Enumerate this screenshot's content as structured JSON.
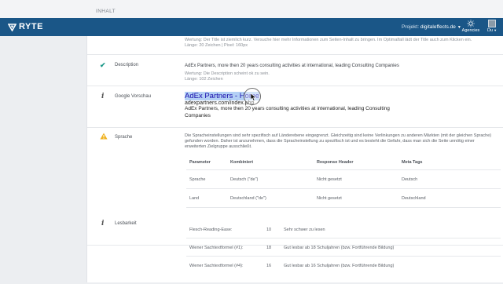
{
  "header": {
    "section_title": "INHALT"
  },
  "navbar": {
    "brand": "RYTE",
    "project_label": "Projekt:",
    "project_value": "digitaleffects.de",
    "agencies_label": "Agencies",
    "user_label": "Du"
  },
  "title_section": {
    "line1": "Wertung: Der Title ist ziemlich kurz. Versuche hier mehr Informationen zum Seiten-Inhalt zu bringen. Im Optimalfall lädt der Title auch zum Klicken ein.",
    "line2": "Länge: 20 Zeichen | Pixel: 160px"
  },
  "description": {
    "label": "Description",
    "text": "AdEx Partners, more then 20 years consulting activities at international, leading Consulting Companies",
    "rating": "Wertung: Die Description scheint ok zu sein.",
    "length": "Länge: 102 Zeichen"
  },
  "google_preview": {
    "label": "Google Vorschau",
    "title": "AdEx Partners - Home",
    "url": "adexpartners.com/index.php",
    "desc_line1": "AdEx Partners, more then 20 years consulting activities at international, leading Consulting",
    "desc_line2": "Companies"
  },
  "sprache": {
    "label": "Sprache",
    "text_line1": "Die Spracheinstellungen sind sehr spezifisch auf Länderebene eingegrenzt. Gleichzeitig sind keine Verlinkungen zu anderen Märkten (mit der gleichen Sprache)",
    "text_line2": "gefunden worden. Daher ist anzunehmen, dass die Spracheinstellung zu spezifisch ist und es besteht die Gefahr, dass man sich die Seite unnötig einer",
    "text_line3": "erweiterten Zielgruppe ausschließt.",
    "columns": [
      "Parameter",
      "Kombiniert",
      "Response Header",
      "Meta Tags"
    ],
    "rows": [
      [
        "Sprache",
        "Deutsch (\"de\")",
        "Nicht gesetzt",
        "Deutsch"
      ],
      [
        "Land",
        "Deutschland (\"de\")",
        "Nicht gesetzt",
        "Deutschland"
      ]
    ]
  },
  "lesbarkeit": {
    "label": "Lesbarkeit",
    "rows": [
      [
        "Flesch-Reading-Ease:",
        "10",
        "Sehr schwer zu lesen"
      ],
      [
        "Wiener Sachtextformel (#1):",
        "18",
        "Gut lesbar ab 18 Schuljahren (bzw. Fortführende Bildung)"
      ],
      [
        "Wiener Sachtextformel (#4):",
        "16",
        "Gut lesbar ab 16 Schuljahren (bzw. Fortführende Bildung)"
      ]
    ]
  }
}
